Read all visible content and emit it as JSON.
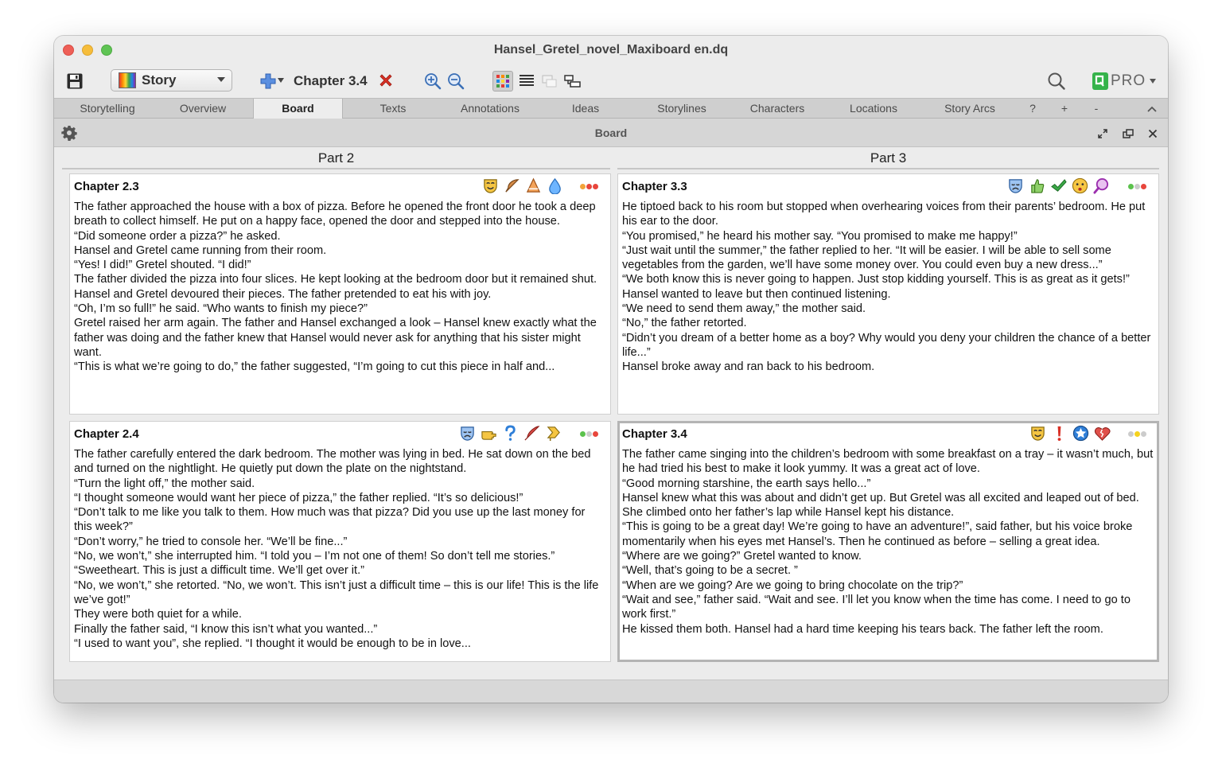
{
  "window": {
    "title": "Hansel_Gretel_novel_Maxiboard en.dq"
  },
  "toolbar": {
    "save_icon": "save-icon",
    "story_select": {
      "value": "Story"
    },
    "chapter": {
      "label": "Chapter 3.4"
    },
    "pro_label": "PRO"
  },
  "tabs": [
    {
      "label": "Storytelling"
    },
    {
      "label": "Overview"
    },
    {
      "label": "Board"
    },
    {
      "label": "Texts"
    },
    {
      "label": "Annotations"
    },
    {
      "label": "Ideas"
    },
    {
      "label": "Storylines"
    },
    {
      "label": "Characters"
    },
    {
      "label": "Locations"
    },
    {
      "label": "Story Arcs"
    },
    {
      "label": "?"
    },
    {
      "label": "+"
    },
    {
      "label": "-"
    }
  ],
  "active_tab": "Board",
  "panel": {
    "title": "Board"
  },
  "board": {
    "parts": [
      {
        "title": "Part 2"
      },
      {
        "title": "Part 3"
      }
    ],
    "cards": [
      {
        "title": "Chapter 2.3",
        "icons": [
          "happy-mask-icon",
          "feather-icon",
          "cone-icon",
          "water-drop-icon"
        ],
        "status_colors": [
          "#f2a33a",
          "#e8463c",
          "#e8463c"
        ],
        "paragraphs": [
          "The father approached the house with a box of pizza. Before he opened the front door he took a deep breath to collect himself. He put on a happy face, opened the door and stepped into the house.",
          "“Did someone order a pizza?” he asked.",
          "Hansel and Gretel came running from their room.",
          "“Yes! I did!” Gretel shouted. “I did!”",
          "The father divided the pizza into four slices. He kept looking at the bedroom door but it remained shut.",
          "Hansel and Gretel devoured their pieces. The father pretended to eat his with joy.",
          "“Oh, I’m so full!” he said. “Who wants to finish my piece?”",
          "Gretel raised her arm again. The father and Hansel exchanged a look – Hansel knew exactly what the father was doing and the father knew that Hansel would never ask for anything that his sister might want.",
          "“This is what we’re going to do,” the father suggested, “I’m going to cut this piece in half and..."
        ]
      },
      {
        "title": "Chapter 3.3",
        "icons": [
          "sad-mask-icon",
          "thumbs-up-icon",
          "checkmark-icon",
          "worried-face-icon",
          "magnifier-icon"
        ],
        "status_colors": [
          "#5cc24d",
          "#cccccc",
          "#e8463c"
        ],
        "paragraphs": [
          "He tiptoed back to his room but stopped when overhearing voices from their parents’ bedroom. He put his ear to the door.",
          "“You promised,” he heard his mother say. “You promised to make me happy!”",
          "“Just wait until the summer,” the father replied to her. “It will be easier. I will be able to sell some vegetables from the garden, we’ll have some money over. You could even buy a new dress...”",
          "“We both know this is never going to happen. Just stop kidding yourself. This is as great as it gets!”",
          "Hansel wanted to leave but then continued listening.",
          "“We need to send them away,” the mother said.",
          "“No,” the father retorted.",
          "“Didn’t you dream of a better home as a boy? Why would you deny your children the chance of a better life...”",
          "Hansel broke away and ran back to his bedroom."
        ]
      },
      {
        "title": "Chapter 2.4",
        "icons": [
          "sad-mask-icon",
          "pointing-hand-icon",
          "question-icon",
          "feather-quill-icon",
          "arrow-sign-icon"
        ],
        "status_colors": [
          "#5cc24d",
          "#cccccc",
          "#e8463c"
        ],
        "paragraphs": [
          "The father carefully entered the dark bedroom. The mother was lying in bed. He sat down on the bed and turned on the nightlight. He quietly put down the plate on the nightstand.",
          "“Turn the light off,” the mother said.",
          "“I thought someone would want her piece of pizza,” the father replied. “It’s so delicious!”",
          "“Don’t talk to me like you talk to them. How much was that pizza? Did you use up the last money for this week?”",
          "“Don’t worry,” he tried to console her. “We’ll be fine...”",
          "“No, we won’t,” she interrupted him. “I told you – I’m not one of them! So don’t tell me stories.”",
          "“Sweetheart. This is just a difficult time. We’ll get over it.”",
          "“No, we won’t,” she retorted. “No, we won’t. This isn’t just a difficult time – this is our life! This is the life we’ve got!”",
          "They were both quiet for a while.",
          "Finally the father said, “I know this isn’t what you wanted...”",
          "“I used to want you”, she replied. “I thought it would be enough to be in love..."
        ]
      },
      {
        "title": "Chapter 3.4",
        "icons": [
          "happy-mask-icon",
          "exclamation-icon",
          "star-badge-icon",
          "broken-heart-icon"
        ],
        "status_colors": [
          "#cccccc",
          "#f5d21e",
          "#cccccc"
        ],
        "paragraphs": [
          "The father came singing into the children’s bedroom with some breakfast on a tray – it wasn’t much, but he had tried his best to make it look yummy. It was a great act of love.",
          "“Good morning starshine, the earth says hello...”",
          "Hansel knew what this was about and didn’t get up. But Gretel was all excited and leaped out of bed. She climbed onto her father’s lap while Hansel kept his distance.",
          "“This is going to be a great day! We’re going to have an adventure!”, said father, but his voice broke momentarily when his eyes met Hansel’s. Then he continued as before – selling a great idea.",
          "“Where are we going?” Gretel wanted to know.",
          "“Well, that’s going to be a secret. ”",
          "“When are we going? Are we going to bring chocolate on the trip?”",
          "“Wait and see,” father said. “Wait and see. I’ll let you know when the time has come. I need to go to work first.”",
          "He kissed them both. Hansel had a hard time keeping his tears back. The father left the room."
        ]
      }
    ]
  }
}
